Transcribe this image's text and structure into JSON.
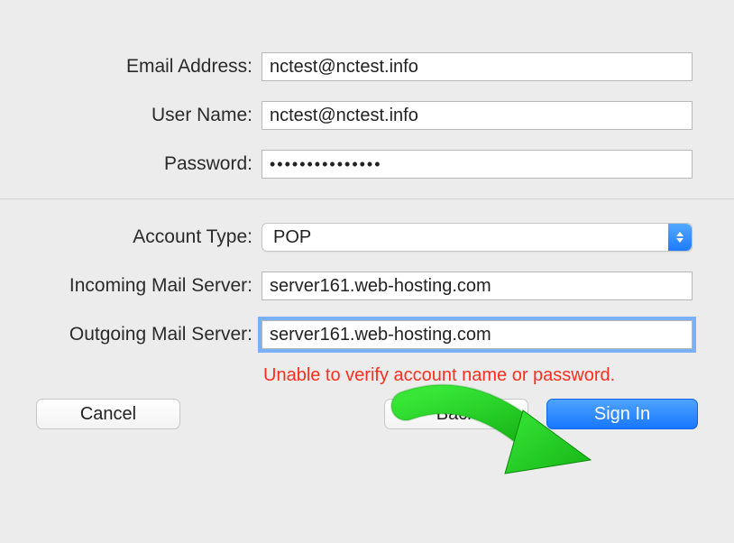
{
  "fields": {
    "email_label": "Email Address:",
    "email_value": "nctest@nctest.info",
    "username_label": "User Name:",
    "username_value": "nctest@nctest.info",
    "password_label": "Password:",
    "password_value": "•••••••••••••••",
    "account_type_label": "Account Type:",
    "account_type_value": "POP",
    "incoming_label": "Incoming Mail Server:",
    "incoming_value": "server161.web-hosting.com",
    "outgoing_label": "Outgoing Mail Server:",
    "outgoing_value": "server161.web-hosting.com"
  },
  "error_message": "Unable to verify account name or password.",
  "buttons": {
    "cancel": "Cancel",
    "back": "Back",
    "signin": "Sign In"
  }
}
